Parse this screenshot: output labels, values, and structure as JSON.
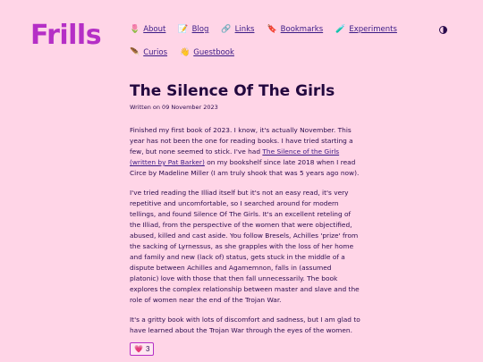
{
  "site": {
    "logo": "Frills"
  },
  "nav": {
    "row1": [
      {
        "icon": "🌷",
        "label": "About"
      },
      {
        "icon": "📝",
        "label": "Blog"
      },
      {
        "icon": "🔗",
        "label": "Links"
      },
      {
        "icon": "🔖",
        "label": "Bookmarks"
      },
      {
        "icon": "🧪",
        "label": "Experiments"
      }
    ],
    "row2": [
      {
        "icon": "🪶",
        "label": "Curios"
      },
      {
        "icon": "👋",
        "label": "Guestbook"
      }
    ]
  },
  "post": {
    "title": "The Silence Of The Girls",
    "date": "Written on 09 November 2023",
    "p1_before": "Finished my first book of 2023. I know, it's actually November. This year has not been the one for reading books. I have tried starting a few, but none seemed to stick. I've had ",
    "p1_link": "The Silence of the Girls (written by Pat Barker)",
    "p1_after": " on my bookshelf since late 2018 when I read Circe by Madeline Miller (I am truly shook that was 5 years ago now).",
    "p2": "I've tried reading the Illiad itself but it's not an easy read, it's very repetitive and uncomfortable, so I searched around for modern tellings, and found Silence Of The Girls. It's an excellent reteling of the Illiad, from the perspective of the women that were objectified, abused, killed and cast aside. You follow Bresels, Achilles 'prize' from the sacking of Lyrnessus, as she grapples with the loss of her home and family and new (lack of) status, gets stuck in the middle of a dispute between Achilles and Agamemnon, falls in (assumed platonic) love with those that then fall unnecessarily. The book explores the complex relationship between master and slave and the role of women near the end of the Trojan War.",
    "p3": "It's a gritty book with lots of discomfort and sadness, but I am glad to have learned about the Trojan War through the eyes of the women."
  },
  "likes": {
    "icon": "💗",
    "count": "3"
  }
}
